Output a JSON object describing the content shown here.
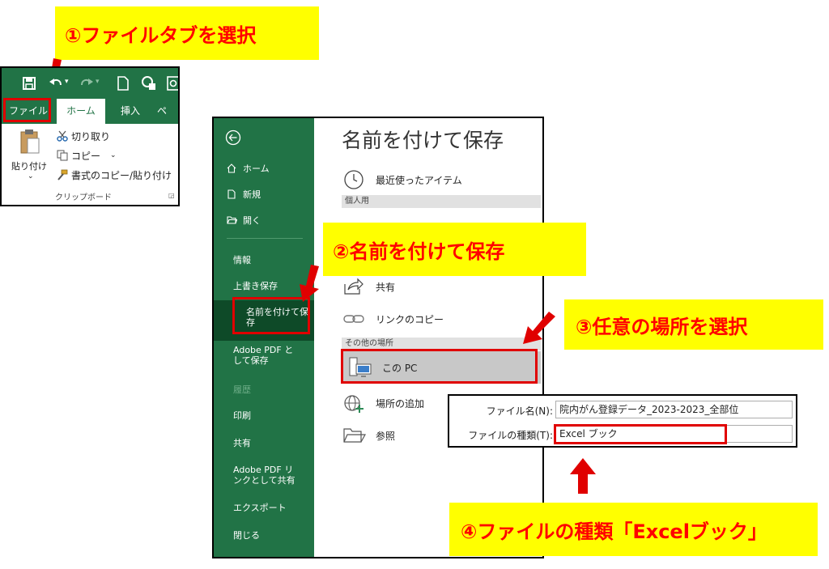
{
  "callouts": {
    "step1": "①ファイルタブを選択",
    "step2": "②名前を付けて保存",
    "step3": "③任意の場所を選択",
    "step4": "④ファイルの種類「Excelブック」"
  },
  "colors": {
    "excel_green": "#217346",
    "callout_yellow": "#ffff00",
    "callout_red": "#ff0000",
    "highlight_gray": "#c8c8c8"
  },
  "ribbon": {
    "qat_icons": [
      "save-icon",
      "undo-icon",
      "redo-icon",
      "new-file-icon",
      "touch-mode-icon",
      "print-preview-icon"
    ],
    "tabs": [
      {
        "label": "ファイル",
        "active": false
      },
      {
        "label": "ホーム",
        "active": true
      },
      {
        "label": "挿入",
        "active": false
      },
      {
        "label": "ペ",
        "active": false
      }
    ],
    "clipboard": {
      "paste_label": "貼り付け",
      "cut_label": "切り取り",
      "copy_label": "コピー",
      "format_painter_label": "書式のコピー/貼り付け",
      "group_label": "クリップボード"
    }
  },
  "backstage": {
    "sidebar": [
      {
        "label": "ホーム",
        "icon": "home-icon"
      },
      {
        "label": "新規",
        "icon": "new-icon"
      },
      {
        "label": "開く",
        "icon": "open-folder-icon"
      },
      {
        "label": "情報"
      },
      {
        "label": "上書き保存"
      },
      {
        "label": "名前を付けて保存",
        "selected": true
      },
      {
        "label": "Adobe PDF として保存"
      },
      {
        "label": "履歴",
        "disabled": true
      },
      {
        "label": "印刷"
      },
      {
        "label": "共有"
      },
      {
        "label": "Adobe PDF リンクとして共有"
      },
      {
        "label": "エクスポート"
      },
      {
        "label": "閉じる"
      }
    ],
    "title": "名前を付けて保存",
    "recent_label": "最近使ったアイテム",
    "personal_header": "個人用",
    "share_label": "共有",
    "link_copy_label": "リンクのコピー",
    "other_header": "その他の場所",
    "this_pc_label": "この PC",
    "add_place_label": "場所の追加",
    "browse_label": "参照"
  },
  "save_fields": {
    "filename_label": "ファイル名(N):",
    "filename_value": "院内がん登録データ_2023-2023_全部位",
    "filetype_label": "ファイルの種類(T):",
    "filetype_value": "Excel ブック"
  }
}
